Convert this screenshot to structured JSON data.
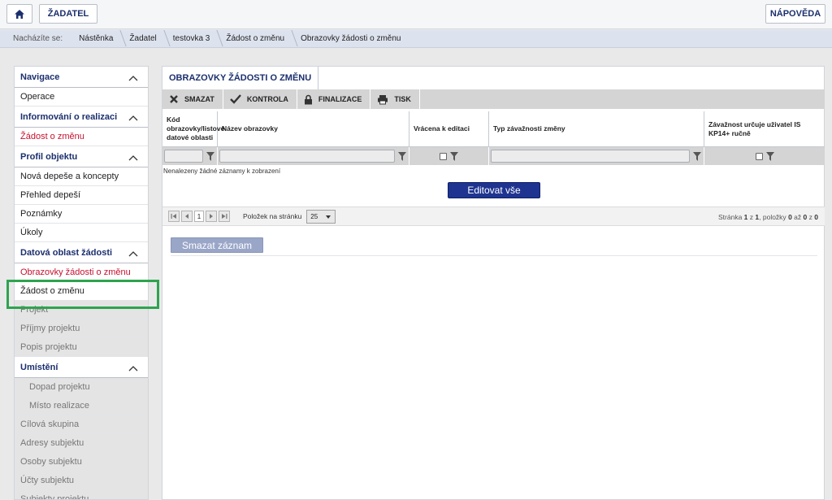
{
  "topbar": {
    "home_icon": "home-icon",
    "zadatel_label": "ŽADATEL",
    "help_label": "NÁPOVĚDA"
  },
  "breadcrumb": {
    "label": "Nacházíte se:",
    "items": [
      "Nástěnka",
      "Žadatel",
      "testovka 3",
      "Žádost o změnu",
      "Obrazovky žádosti o změnu"
    ]
  },
  "sidebar": {
    "navigace": "Navigace",
    "operace": "Operace",
    "informovani": "Informování o realizaci",
    "zadost_zmena": "Žádost o změnu",
    "profil": "Profil objektu",
    "nova_depese": "Nová depeše a koncepty",
    "prehled_depesi": "Přehled depeší",
    "poznamky": "Poznámky",
    "ukoly": "Úkoly",
    "datova_oblast": "Datová oblast žádosti",
    "obrazovky": "Obrazovky žádosti o změnu",
    "zadost_o_zmenu": "Žádost o změnu",
    "projekt": "Projekt",
    "prijmy": "Příjmy projektu",
    "popis": "Popis projektu",
    "umisteni": "Umístění",
    "dopad": "Dopad projektu",
    "misto": "Místo realizace",
    "cilova": "Cílová skupina",
    "adresy": "Adresy subjektu",
    "osoby": "Osoby subjektu",
    "ucty": "Účty subjektu",
    "subjekty": "Subjekty projektu"
  },
  "main": {
    "tab": "OBRAZOVKY ŽÁDOSTI O ZMĚNU",
    "toolbar": {
      "smazat": "SMAZAT",
      "kontrola": "KONTROLA",
      "finalizace": "FINALIZACE",
      "tisk": "TISK"
    },
    "columns": {
      "kod": "Kód obrazovky/listové datové oblasti",
      "nazev": "Název obrazovky",
      "vracena": "Vrácena k editaci",
      "typ": "Typ závažnosti změny",
      "zavaznost": "Závažnost určuje uživatel IS KP14+ ručně"
    },
    "no_records": "Nenalezeny žádné záznamy k zobrazení",
    "edit_all": "Editovat vše",
    "pager": {
      "page": "1",
      "per_page_label": "Položek na stránku",
      "per_page_value": "25",
      "info_prefix": "Stránka",
      "info_page": "1",
      "info_of": "z",
      "info_pages": "1",
      "info_items": ", položky",
      "info_from": "0",
      "info_to_word": "až",
      "info_to": "0",
      "info_z2": "z",
      "info_total": "0"
    },
    "delete_record": "Smazat záznam"
  },
  "colors": {
    "brand": "#1b2f6e",
    "active": "#c8102e",
    "highlight": "#2ea44f",
    "primary_button": "#1e3490"
  }
}
